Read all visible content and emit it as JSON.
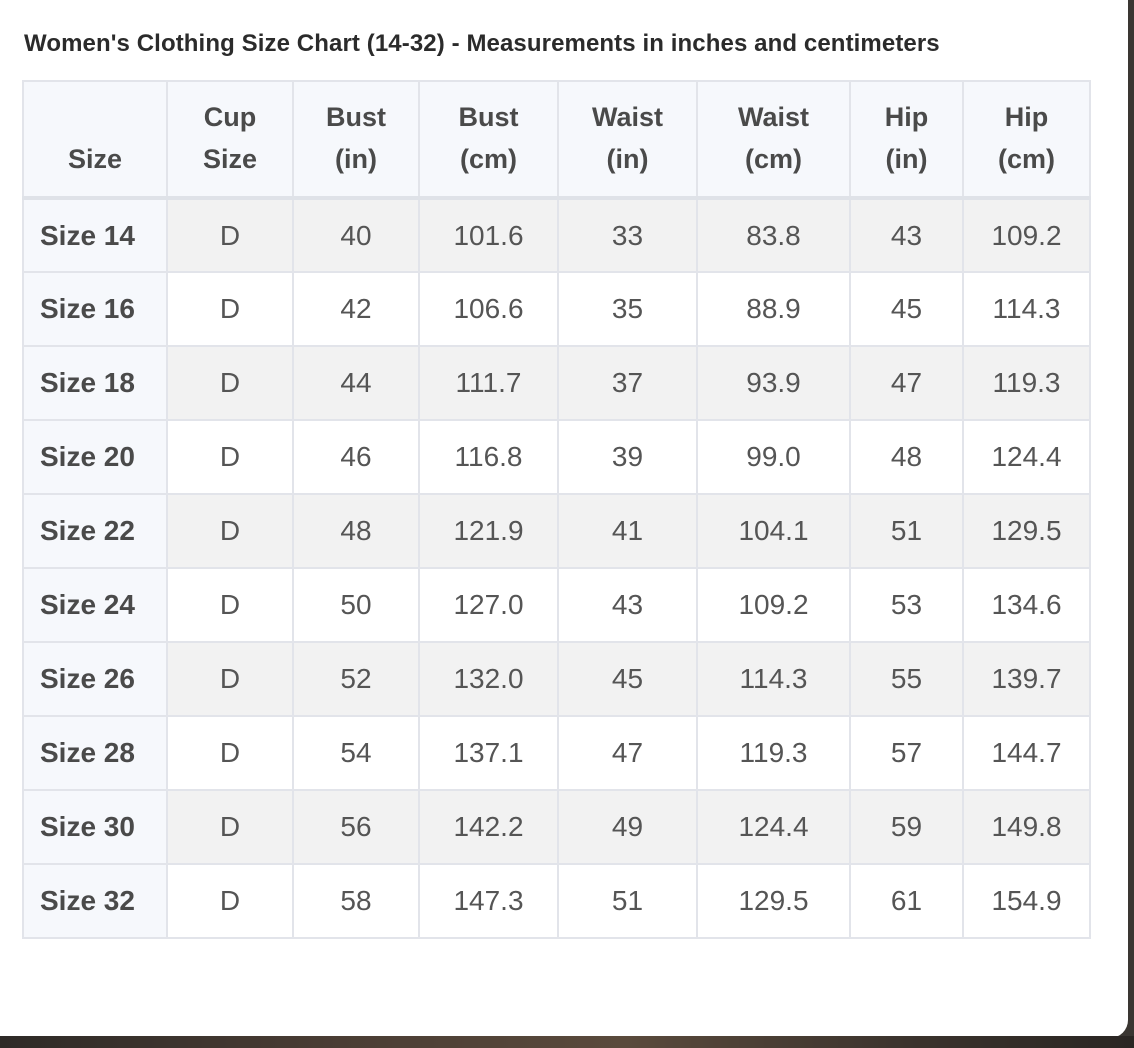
{
  "title": "Women's Clothing Size Chart (14-32) - Measurements in inches and centimeters",
  "chart_data": {
    "type": "table",
    "title": "Women's Clothing Size Chart (14-32) - Measurements in inches and centimeters",
    "columns": [
      {
        "line1": "",
        "line2": "Size"
      },
      {
        "line1": "Cup",
        "line2": "Size"
      },
      {
        "line1": "Bust",
        "line2": "(in)"
      },
      {
        "line1": "Bust",
        "line2": "(cm)"
      },
      {
        "line1": "Waist",
        "line2": "(in)"
      },
      {
        "line1": "Waist",
        "line2": "(cm)"
      },
      {
        "line1": "Hip",
        "line2": "(in)"
      },
      {
        "line1": "Hip",
        "line2": "(cm)"
      }
    ],
    "rows": [
      [
        "Size 14",
        "D",
        "40",
        "101.6",
        "33",
        "83.8",
        "43",
        "109.2"
      ],
      [
        "Size 16",
        "D",
        "42",
        "106.6",
        "35",
        "88.9",
        "45",
        "114.3"
      ],
      [
        "Size 18",
        "D",
        "44",
        "111.7",
        "37",
        "93.9",
        "47",
        "119.3"
      ],
      [
        "Size 20",
        "D",
        "46",
        "116.8",
        "39",
        "99.0",
        "48",
        "124.4"
      ],
      [
        "Size 22",
        "D",
        "48",
        "121.9",
        "41",
        "104.1",
        "51",
        "129.5"
      ],
      [
        "Size 24",
        "D",
        "50",
        "127.0",
        "43",
        "109.2",
        "53",
        "134.6"
      ],
      [
        "Size 26",
        "D",
        "52",
        "132.0",
        "45",
        "114.3",
        "55",
        "139.7"
      ],
      [
        "Size 28",
        "D",
        "54",
        "137.1",
        "47",
        "119.3",
        "57",
        "144.7"
      ],
      [
        "Size 30",
        "D",
        "56",
        "142.2",
        "49",
        "124.4",
        "59",
        "149.8"
      ],
      [
        "Size 32",
        "D",
        "58",
        "147.3",
        "51",
        "129.5",
        "61",
        "154.9"
      ]
    ]
  }
}
